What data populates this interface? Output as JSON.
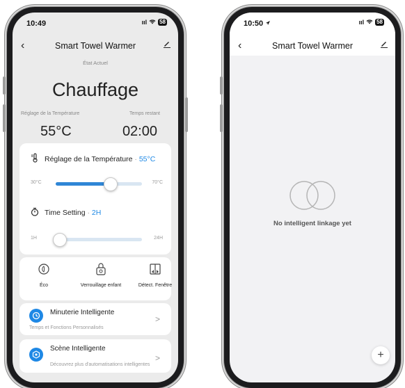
{
  "left": {
    "status": {
      "time": "10:49",
      "signal": "ııl",
      "battery": "58"
    },
    "nav": {
      "back": "‹",
      "title": "Smart Towel Warmer",
      "edit": "✎"
    },
    "state_label": "État Actuel",
    "mode": "Chauffage",
    "temp_label": "Réglage de la Température",
    "time_label": "Temps restant",
    "temp_value": "55°C",
    "time_value": "02:00",
    "temp_setting": {
      "title": "Réglage de la Température",
      "separator": "·",
      "value": "55°C",
      "min": "30°C",
      "max": "70°C",
      "level": 0.625
    },
    "time_setting": {
      "title": "Time Setting",
      "separator": "·",
      "value": "2H",
      "min": "1H",
      "max": "24H",
      "level": 0.04
    },
    "features": [
      {
        "label": "Éco",
        "icon": "eco-icon"
      },
      {
        "label": "Verrouillage enfant",
        "icon": "child-lock-icon"
      },
      {
        "label": "Détect. Fenêtre",
        "icon": "window-detect-icon"
      }
    ],
    "timer": {
      "title": "Minuterie Intelligente",
      "subtitle": "Temps et Fonctions Personnalisés",
      "chevron": ">"
    },
    "scene": {
      "title": "Scène Intelligente",
      "subtitle": "Découvrez plus d'automatisations intelligentes",
      "chevron": ">"
    },
    "accent_color": "#1e88e5"
  },
  "right": {
    "status": {
      "time": "10:50",
      "signal": "ııl",
      "battery": "58"
    },
    "nav": {
      "back": "‹",
      "title": "Smart Towel Warmer",
      "edit": "✎"
    },
    "empty_text": "No intelligent linkage yet",
    "fab": "+"
  }
}
